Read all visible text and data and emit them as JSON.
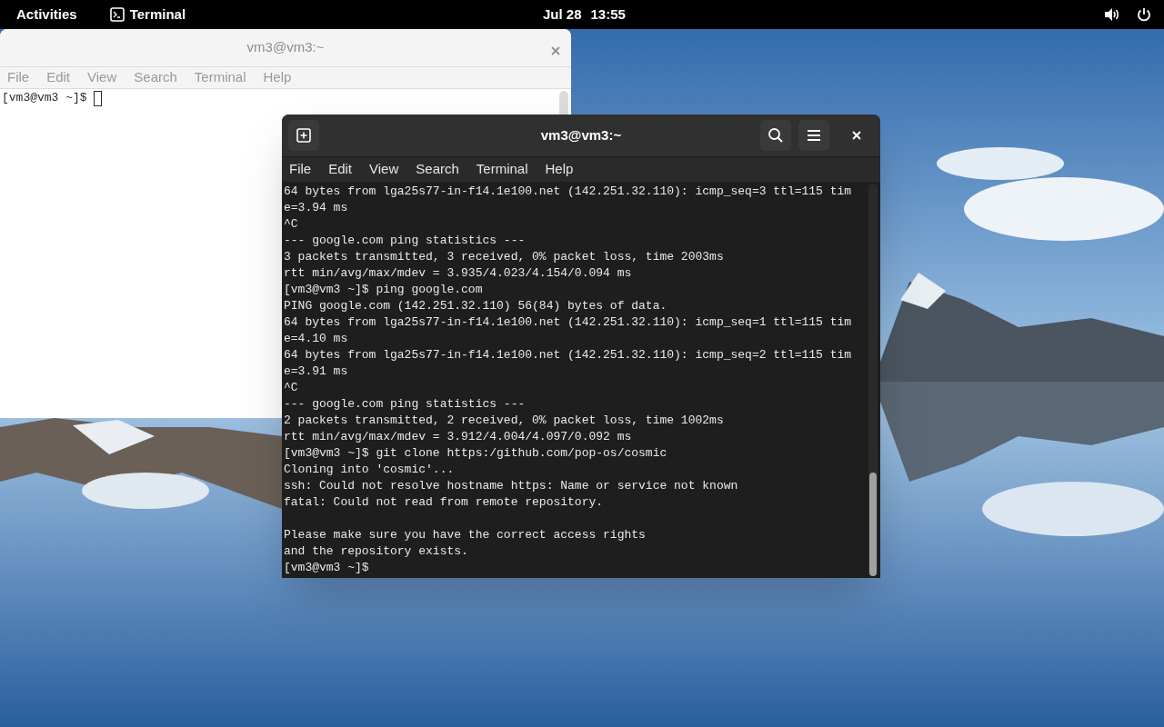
{
  "top_bar": {
    "activities": "Activities",
    "app": "Terminal",
    "date": "Jul 28",
    "time": "13:55"
  },
  "windows": [
    {
      "kind": "light",
      "title": "vm3@vm3:~",
      "menu": [
        "File",
        "Edit",
        "View",
        "Search",
        "Terminal",
        "Help"
      ],
      "lines": [
        {
          "text": "[vm3@vm3 ~]$ "
        }
      ]
    },
    {
      "kind": "dark",
      "title": "vm3@vm3:~",
      "menu": [
        "File",
        "Edit",
        "View",
        "Search",
        "Terminal",
        "Help"
      ],
      "lines": [
        {
          "text": "64 bytes from lga25s77-in-f14.1e100.net (142.251.32.110): icmp_seq=3 ttl=115 tim"
        },
        {
          "text": "e=3.94 ms"
        },
        {
          "text": "^C"
        },
        {
          "text": "--- google.com ping statistics ---"
        },
        {
          "text": "3 packets transmitted, 3 received, 0% packet loss, time 2003ms"
        },
        {
          "text": "rtt min/avg/max/mdev = 3.935/4.023/4.154/0.094 ms"
        },
        {
          "text": "[vm3@vm3 ~]$ ping google.com"
        },
        {
          "text": "PING google.com (142.251.32.110) 56(84) bytes of data."
        },
        {
          "text": "64 bytes from lga25s77-in-f14.1e100.net (142.251.32.110): icmp_seq=1 ttl=115 tim"
        },
        {
          "text": "e=4.10 ms"
        },
        {
          "text": "64 bytes from lga25s77-in-f14.1e100.net (142.251.32.110): icmp_seq=2 ttl=115 tim"
        },
        {
          "text": "e=3.91 ms"
        },
        {
          "text": "^C"
        },
        {
          "text": "--- google.com ping statistics ---"
        },
        {
          "text": "2 packets transmitted, 2 received, 0% packet loss, time 1002ms"
        },
        {
          "text": "rtt min/avg/max/mdev = 3.912/4.004/4.097/0.092 ms"
        },
        {
          "text": "[vm3@vm3 ~]$ git clone https:/github.com/pop-os/cosmic"
        },
        {
          "text": "Cloning into 'cosmic'..."
        },
        {
          "text": "ssh: Could not resolve hostname https: Name or service not known"
        },
        {
          "text": "fatal: Could not read from remote repository."
        },
        {
          "text": "Please make sure you have the correct access rights",
          "blank_before": true
        },
        {
          "text": "and the repository exists."
        },
        {
          "text": "[vm3@vm3 ~]$ "
        }
      ]
    }
  ]
}
